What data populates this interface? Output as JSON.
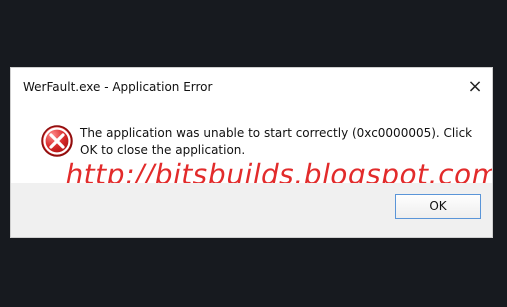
{
  "window": {
    "title": "WerFault.exe - Application Error",
    "close_glyph": "×"
  },
  "dialog": {
    "icon": "error-icon",
    "message": "The application was unable to start correctly (0xc0000005). Click OK to close the application.",
    "button_ok": "OK",
    "watermark": "http://bitsbuilds.blogspot.com/"
  },
  "colors": {
    "background": "#171a1f",
    "dialog_bg": "#ffffff",
    "footer_bg": "#f0f0f0",
    "button_border": "#5a95d8",
    "error_red": "#d92b2b",
    "watermark_red": "#dc0000"
  }
}
